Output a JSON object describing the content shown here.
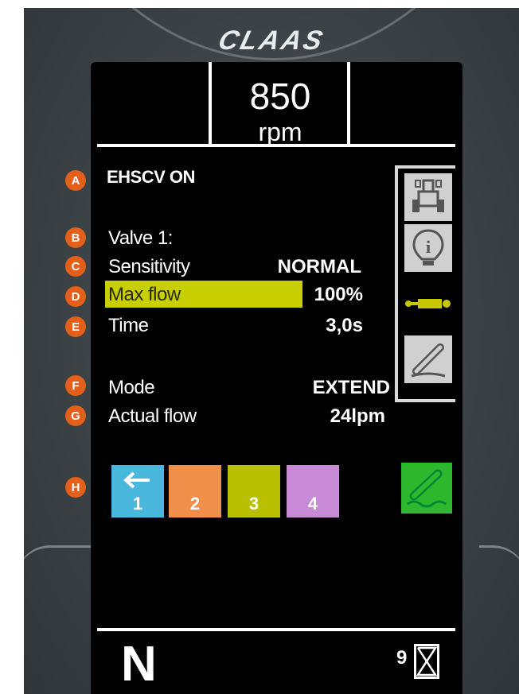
{
  "brand": "CLAAS",
  "engine": {
    "rpm_value": "850",
    "rpm_unit": "rpm"
  },
  "status": "EHSCV ON",
  "valve_title": "Valve 1:",
  "settings": [
    {
      "label": "Sensitivity",
      "value": "NORMAL"
    },
    {
      "label": "Max flow",
      "value": "100%"
    },
    {
      "label": "Time",
      "value": "3,0s"
    }
  ],
  "mode": {
    "label": "Mode",
    "value": "EXTEND"
  },
  "actual_flow": {
    "label": "Actual flow",
    "value": "24lpm"
  },
  "valves": [
    {
      "number": "1",
      "color": "#4ab8dc",
      "icon": "arrow-left-icon"
    },
    {
      "number": "2",
      "color": "#ef8f4a"
    },
    {
      "number": "3",
      "color": "#b8c000"
    },
    {
      "number": "4",
      "color": "#c88ad4"
    }
  ],
  "side_icons": [
    "tractor-icon",
    "info-bulb-icon",
    "hydraulic-cylinder-icon",
    "loader-arm-icon"
  ],
  "bottom": {
    "gear": "N",
    "hour_count": "9"
  },
  "markers": [
    "A",
    "B",
    "C",
    "D",
    "E",
    "F",
    "G",
    "H"
  ],
  "colors": {
    "highlight": "#c8cf00",
    "marker": "#e35f1a",
    "green_button": "#2db82d"
  }
}
